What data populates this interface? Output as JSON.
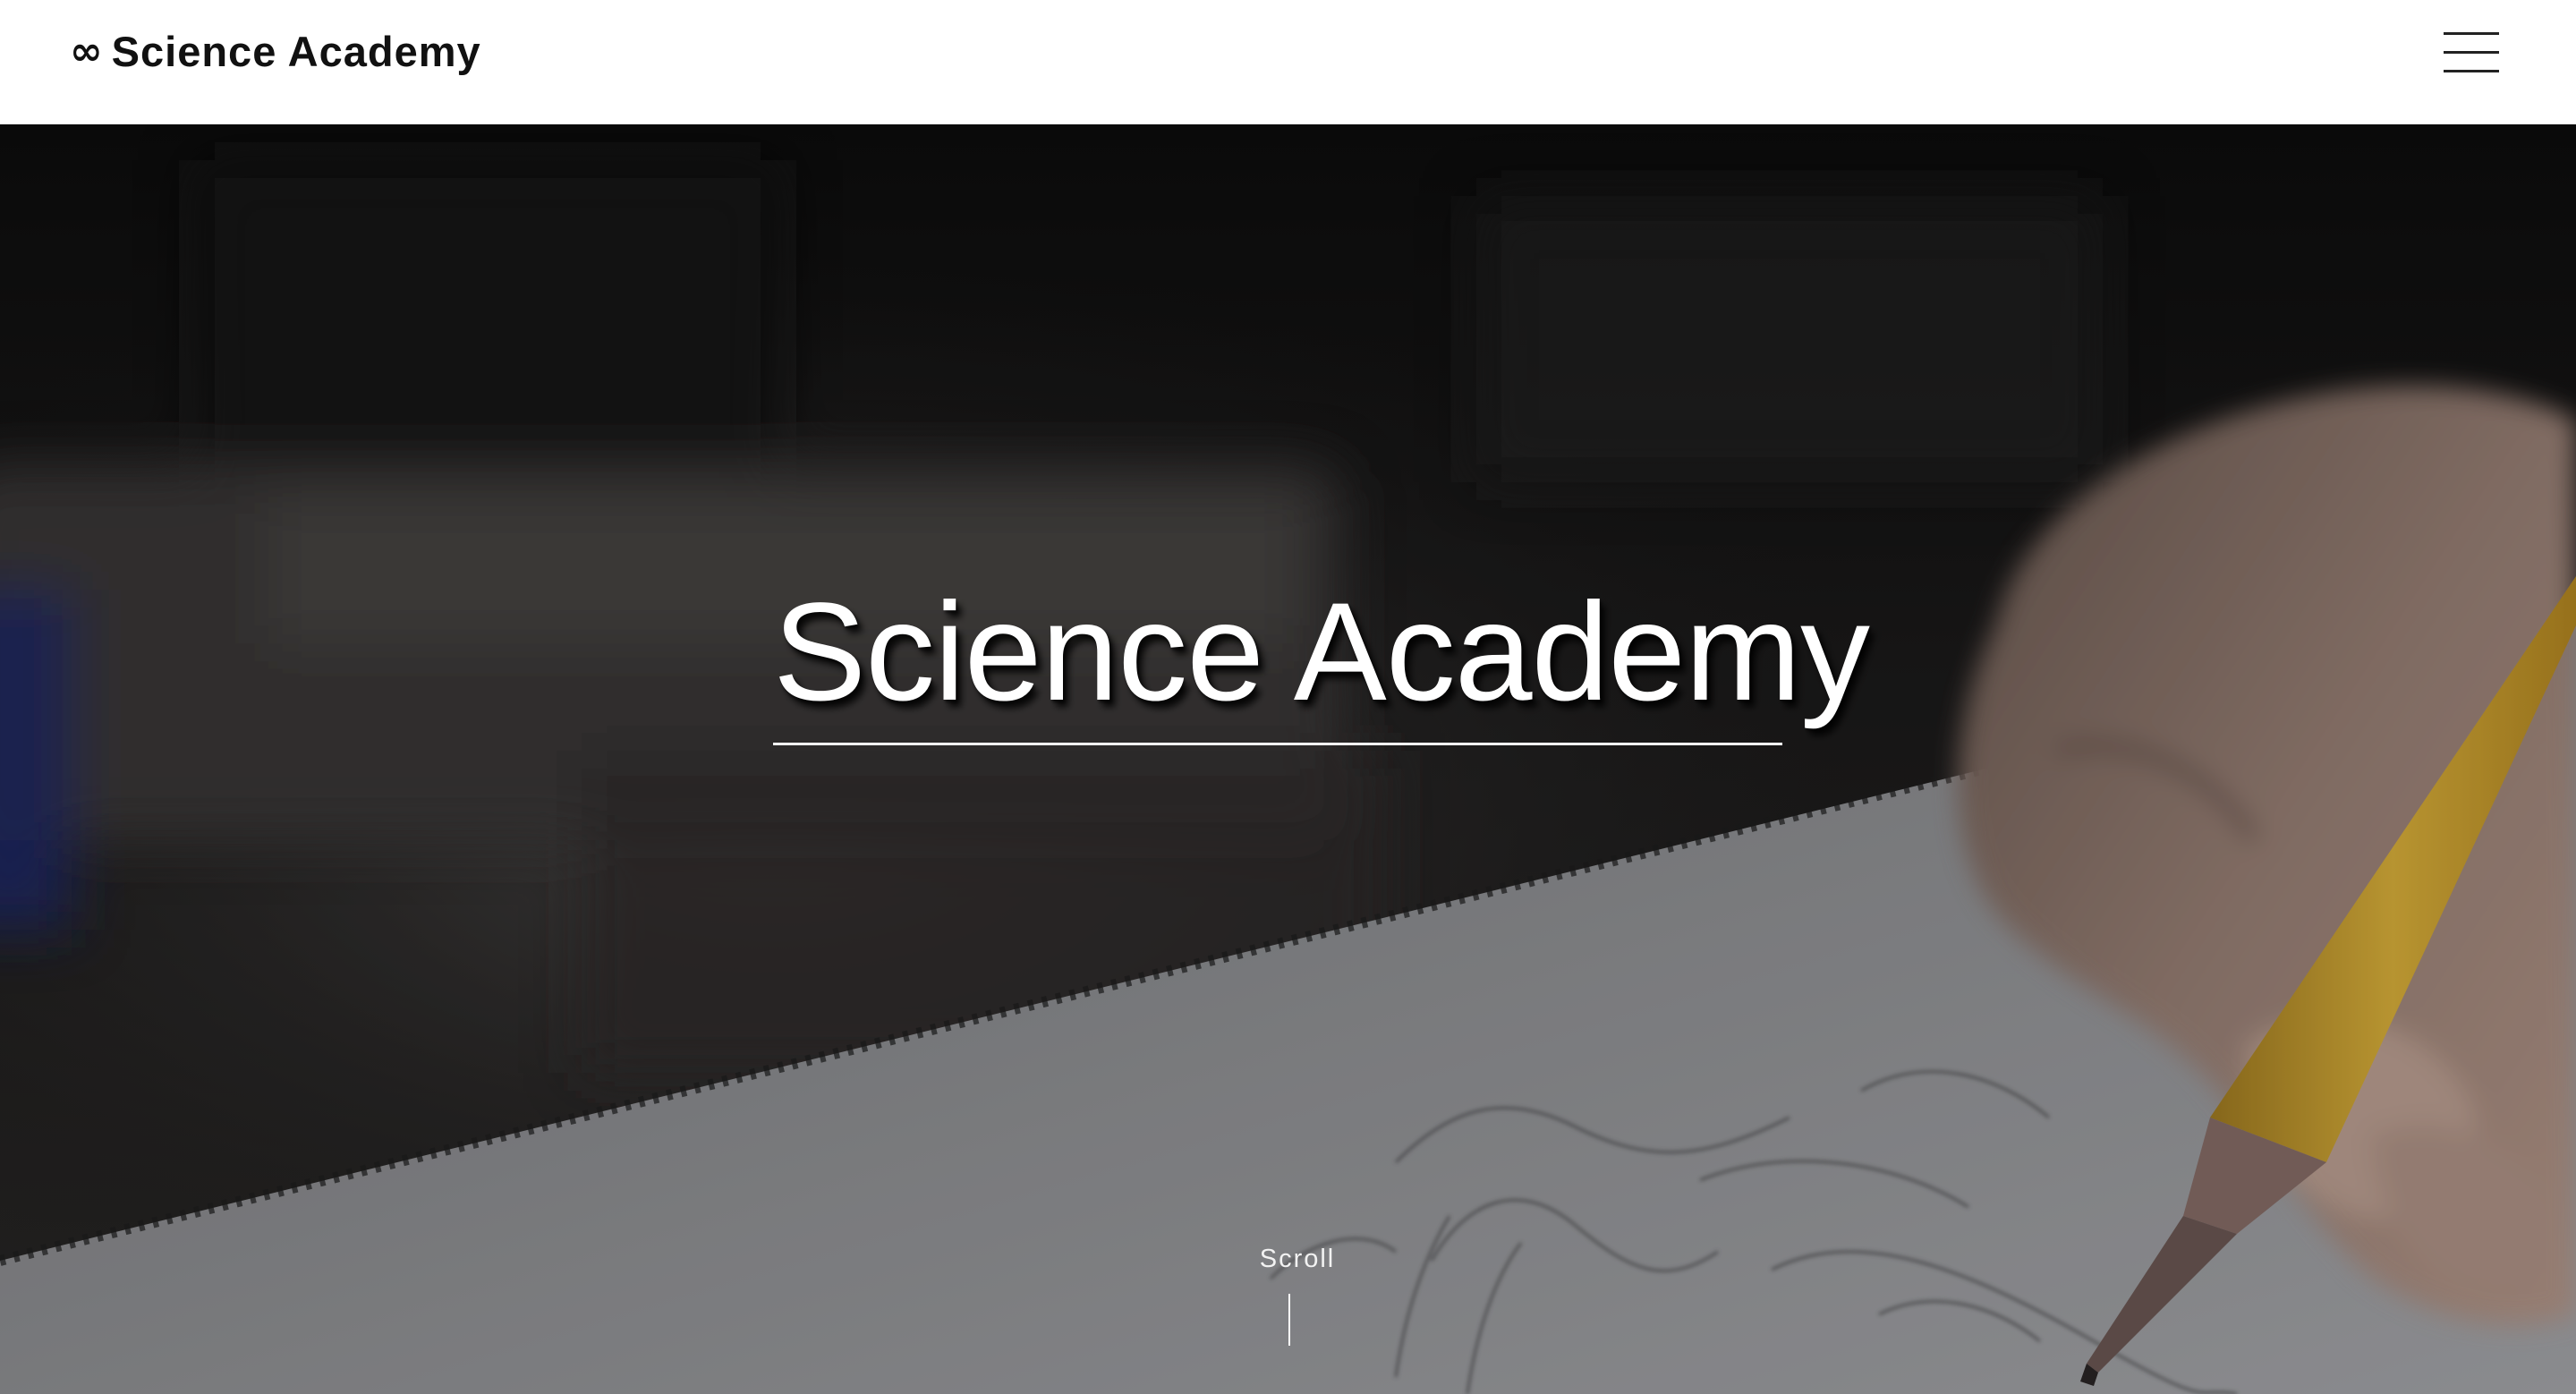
{
  "header": {
    "logo_icon": "∞",
    "logo_icon_name": "infinity-icon",
    "logo_text": "Science Academy",
    "menu_icon_name": "hamburger-menu-icon"
  },
  "hero": {
    "title": "Science Academy",
    "scroll_label": "Scroll",
    "background_image": "hand sketching with yellow pencil on paper",
    "text_color": "#ffffff"
  },
  "colors": {
    "header_background": "#ffffff",
    "header_text": "#111111",
    "hero_overlay_dark": "#151414"
  }
}
